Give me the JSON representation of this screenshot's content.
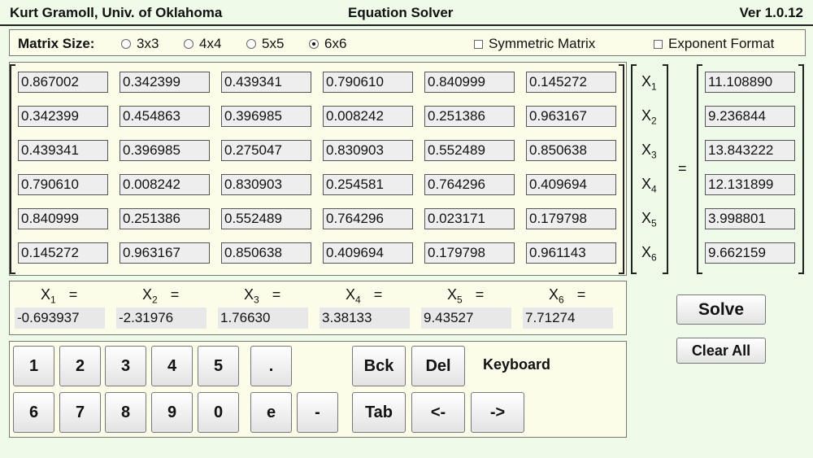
{
  "header": {
    "author": "Kurt Gramoll, Univ. of Oklahoma",
    "title": "Equation Solver",
    "version": "Ver 1.0.12"
  },
  "matrix_size": {
    "label": "Matrix Size:",
    "options": [
      "3x3",
      "4x4",
      "5x5",
      "6x6"
    ],
    "selected": "6x6"
  },
  "options": {
    "symmetric": "Symmetric Matrix",
    "exponent": "Exponent Format"
  },
  "matrix": [
    [
      "0.867002",
      "0.342399",
      "0.439341",
      "0.790610",
      "0.840999",
      "0.145272"
    ],
    [
      "0.342399",
      "0.454863",
      "0.396985",
      "0.008242",
      "0.251386",
      "0.963167"
    ],
    [
      "0.439341",
      "0.396985",
      "0.275047",
      "0.830903",
      "0.552489",
      "0.850638"
    ],
    [
      "0.790610",
      "0.008242",
      "0.830903",
      "0.254581",
      "0.764296",
      "0.409694"
    ],
    [
      "0.840999",
      "0.251386",
      "0.552489",
      "0.764296",
      "0.023171",
      "0.179798"
    ],
    [
      "0.145272",
      "0.963167",
      "0.850638",
      "0.409694",
      "0.179798",
      "0.961143"
    ]
  ],
  "variable_symbol": "X",
  "variable_indices": [
    "1",
    "2",
    "3",
    "4",
    "5",
    "6"
  ],
  "equals_sign": "=",
  "rhs": [
    "11.108890",
    "9.236844",
    "13.843222",
    "12.131899",
    "3.998801",
    "9.662159"
  ],
  "solution": [
    "-0.693937",
    "-2.31976",
    "1.76630",
    "3.38133",
    "9.43527",
    "7.71274"
  ],
  "buttons": {
    "solve": "Solve",
    "clear": "Clear All"
  },
  "keyboard": {
    "label": "Keyboard",
    "row1_digits": [
      "1",
      "2",
      "3",
      "4",
      "5"
    ],
    "row2_digits": [
      "6",
      "7",
      "8",
      "9",
      "0"
    ],
    "dot": ".",
    "e": "e",
    "minus": "-",
    "bck": "Bck",
    "del": "Del",
    "tab": "Tab",
    "left": "<-",
    "right": "->"
  }
}
